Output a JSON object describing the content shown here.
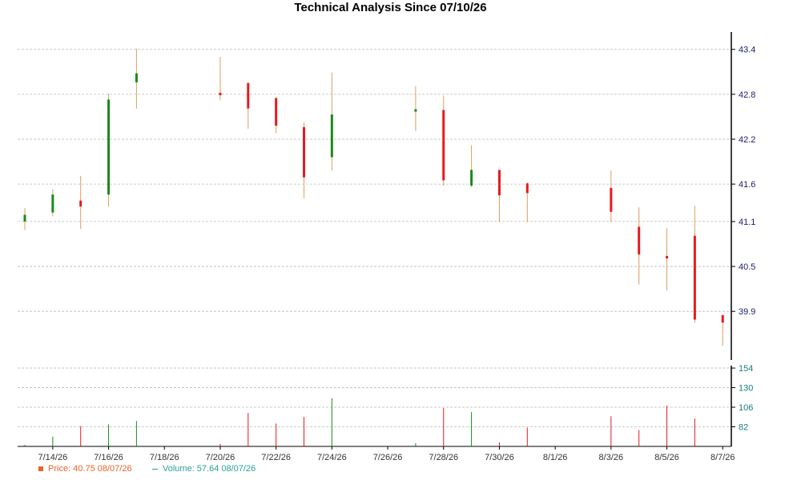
{
  "chart_data": {
    "type": "candlestick",
    "title": "Technical Analysis Since 07/10/26",
    "x_ticks": [
      "7/14/26",
      "7/16/26",
      "7/18/26",
      "7/20/26",
      "7/22/26",
      "7/24/26",
      "7/26/26",
      "7/28/26",
      "7/30/26",
      "8/1/26",
      "8/3/26",
      "8/5/26",
      "8/7/26"
    ],
    "price_axis": {
      "ticks": [
        39.9,
        40.5,
        41.1,
        41.6,
        42.2,
        42.8,
        43.4
      ],
      "ylim": [
        39.25,
        43.6
      ],
      "grid": true
    },
    "volume_axis": {
      "ticks": [
        82,
        106,
        130,
        154
      ],
      "ylim": [
        58,
        157
      ],
      "grid": true
    },
    "candles": [
      {
        "date": "7/13/26",
        "open": 41.1,
        "high": 41.28,
        "low": 40.99,
        "close": 41.19,
        "volume": 60
      },
      {
        "date": "7/14/26",
        "open": 41.22,
        "high": 41.53,
        "low": 41.17,
        "close": 41.46,
        "volume": 70
      },
      {
        "date": "7/15/26",
        "open": 41.38,
        "high": 41.71,
        "low": 41.0,
        "close": 41.3,
        "volume": 83
      },
      {
        "date": "7/16/26",
        "open": 41.46,
        "high": 42.81,
        "low": 41.3,
        "close": 42.73,
        "volume": 85
      },
      {
        "date": "7/17/26",
        "open": 42.96,
        "high": 43.41,
        "low": 42.61,
        "close": 43.08,
        "volume": 89
      },
      {
        "date": "7/20/26",
        "open": 42.82,
        "high": 43.3,
        "low": 42.72,
        "close": 42.79,
        "volume": 61
      },
      {
        "date": "7/21/26",
        "open": 42.95,
        "high": 42.96,
        "low": 42.34,
        "close": 42.61,
        "volume": 99
      },
      {
        "date": "7/22/26",
        "open": 42.75,
        "high": 42.76,
        "low": 42.28,
        "close": 42.38,
        "volume": 86
      },
      {
        "date": "7/23/26",
        "open": 42.36,
        "high": 42.42,
        "low": 41.41,
        "close": 41.69,
        "volume": 94
      },
      {
        "date": "7/24/26",
        "open": 41.96,
        "high": 43.09,
        "low": 41.78,
        "close": 42.53,
        "volume": 117
      },
      {
        "date": "7/27/26",
        "open": 42.58,
        "high": 42.91,
        "low": 42.31,
        "close": 42.6,
        "volume": 62
      },
      {
        "date": "7/28/26",
        "open": 42.59,
        "high": 42.78,
        "low": 41.58,
        "close": 41.65,
        "volume": 105
      },
      {
        "date": "7/29/26",
        "open": 41.58,
        "high": 42.12,
        "low": 41.56,
        "close": 41.79,
        "volume": 100
      },
      {
        "date": "7/30/26",
        "open": 41.79,
        "high": 41.79,
        "low": 41.09,
        "close": 41.45,
        "volume": 63
      },
      {
        "date": "7/31/26",
        "open": 41.61,
        "high": 41.62,
        "low": 41.09,
        "close": 41.48,
        "volume": 81
      },
      {
        "date": "8/3/26",
        "open": 41.55,
        "high": 41.78,
        "low": 41.09,
        "close": 41.23,
        "volume": 95
      },
      {
        "date": "8/4/26",
        "open": 41.03,
        "high": 41.29,
        "low": 40.26,
        "close": 40.66,
        "volume": 78
      },
      {
        "date": "8/5/26",
        "open": 40.64,
        "high": 41.01,
        "low": 40.18,
        "close": 40.61,
        "volume": 108
      },
      {
        "date": "8/6/26",
        "open": 40.91,
        "high": 41.31,
        "low": 39.75,
        "close": 39.79,
        "volume": 92
      },
      {
        "date": "8/7/26",
        "open": 39.85,
        "high": 39.85,
        "low": 39.44,
        "close": 39.75,
        "volume": 58
      }
    ],
    "legend": {
      "position": "bottom-left",
      "price_text": "Price: 40.75  08/07/26",
      "volume_text": "Volume: 57.64  08/07/26"
    },
    "colors": {
      "up": "#1a8a1a",
      "down": "#e8191f",
      "wick": "#d9a060",
      "grid": "#bbbbbb",
      "axis": "#000000"
    }
  }
}
